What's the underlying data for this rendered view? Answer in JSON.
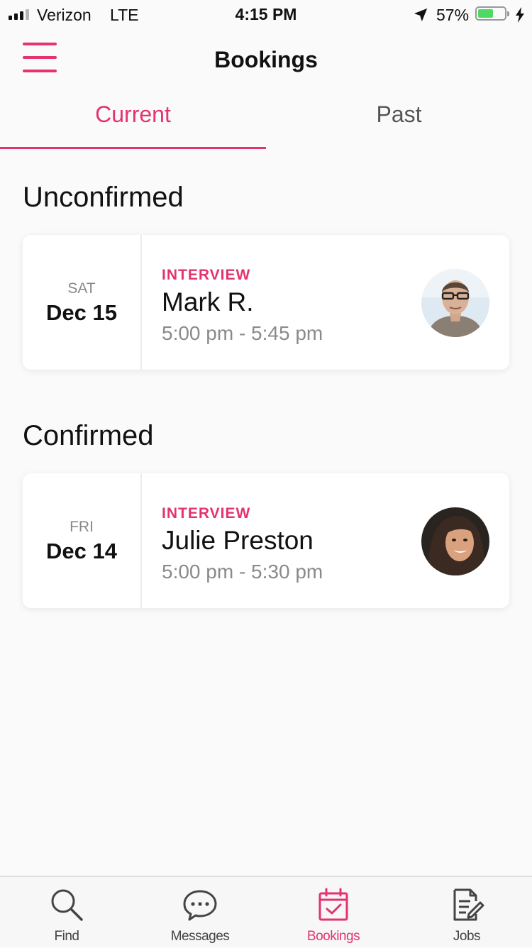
{
  "status_bar": {
    "carrier": "Verizon",
    "network": "LTE",
    "time": "4:15 PM",
    "battery_percent": "57%",
    "battery_level": 0.57
  },
  "header": {
    "title": "Bookings",
    "menu_icon": "hamburger-icon"
  },
  "tabs": {
    "current": "Current",
    "past": "Past",
    "active": "current"
  },
  "sections": {
    "unconfirmed": {
      "heading": "Unconfirmed",
      "booking": {
        "day_of_week": "SAT",
        "date": "Dec 15",
        "type": "INTERVIEW",
        "name": "Mark R.",
        "time": "5:00 pm - 5:45 pm"
      }
    },
    "confirmed": {
      "heading": "Confirmed",
      "booking": {
        "day_of_week": "FRI",
        "date": "Dec 14",
        "type": "INTERVIEW",
        "name": "Julie Preston",
        "time": "5:00 pm - 5:30 pm"
      }
    }
  },
  "tab_bar": {
    "find": "Find",
    "messages": "Messages",
    "bookings": "Bookings",
    "jobs": "Jobs",
    "active": "bookings"
  },
  "colors": {
    "accent": "#e4336e",
    "background": "#fafafa",
    "muted_text": "#8a8a8a"
  }
}
